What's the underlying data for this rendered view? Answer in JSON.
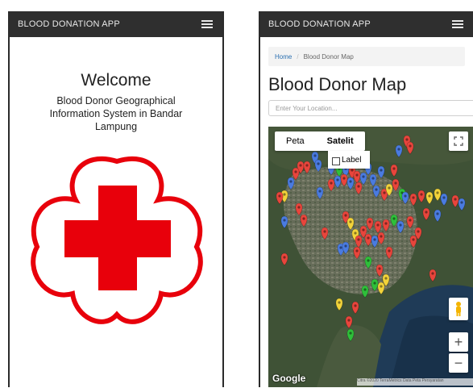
{
  "left_screen": {
    "app_title": "BLOOD DONATION APP",
    "heading": "Welcome",
    "subtitle": "Blood Donor Geographical Information System in Bandar Lampung"
  },
  "right_screen": {
    "app_title": "BLOOD DONATION APP",
    "breadcrumb": {
      "home": "Home",
      "separator": "/",
      "current": "Blood Donor Map"
    },
    "title": "Blood Donor Map",
    "location_placeholder": "Enter Your Location...",
    "map": {
      "type_buttons": [
        "Peta",
        "Satelit"
      ],
      "selected_type": "Satelit",
      "label_option": "Label",
      "label_checked": false,
      "zoom_in": "+",
      "zoom_out": "−",
      "provider": "Google",
      "attribution": "Citra ©2020 TerraMetrics  Data Peta  Persyaratan"
    }
  },
  "colors": {
    "appbar": "#2f2f2f",
    "logo_red": "#e8000b",
    "pin_red": "#e8453c",
    "pin_blue": "#4a7be0",
    "pin_yellow": "#f2d33a",
    "pin_green": "#2fbf3a"
  },
  "icons": [
    "menu-icon",
    "red-cross-logo",
    "fullscreen-icon",
    "pegman-icon",
    "map-pin-icon"
  ]
}
